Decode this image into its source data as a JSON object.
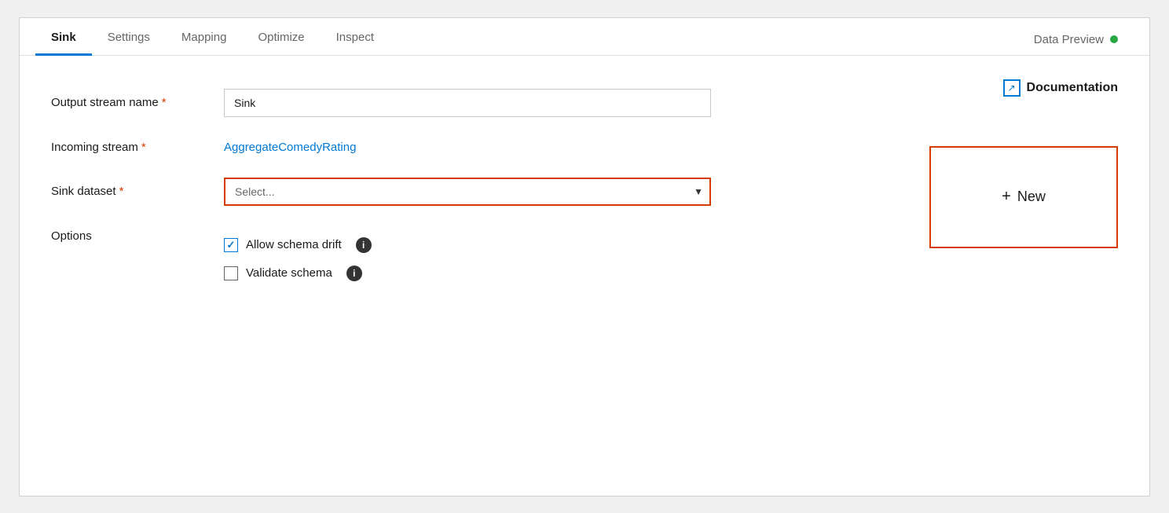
{
  "tabs": [
    {
      "id": "sink",
      "label": "Sink",
      "active": true
    },
    {
      "id": "settings",
      "label": "Settings",
      "active": false
    },
    {
      "id": "mapping",
      "label": "Mapping",
      "active": false
    },
    {
      "id": "optimize",
      "label": "Optimize",
      "active": false
    },
    {
      "id": "inspect",
      "label": "Inspect",
      "active": false
    },
    {
      "id": "data-preview",
      "label": "Data Preview",
      "active": false
    }
  ],
  "form": {
    "output_stream_name_label": "Output stream name",
    "output_stream_name_value": "Sink",
    "output_stream_name_placeholder": "Sink",
    "incoming_stream_label": "Incoming stream",
    "incoming_stream_value": "AggregateComedyRating",
    "sink_dataset_label": "Sink dataset",
    "sink_dataset_placeholder": "Select...",
    "options_label": "Options",
    "allow_schema_drift_label": "Allow schema drift",
    "validate_schema_label": "Validate schema"
  },
  "documentation": {
    "label": "Documentation"
  },
  "new_button": {
    "label": "New"
  },
  "required_star": "*"
}
